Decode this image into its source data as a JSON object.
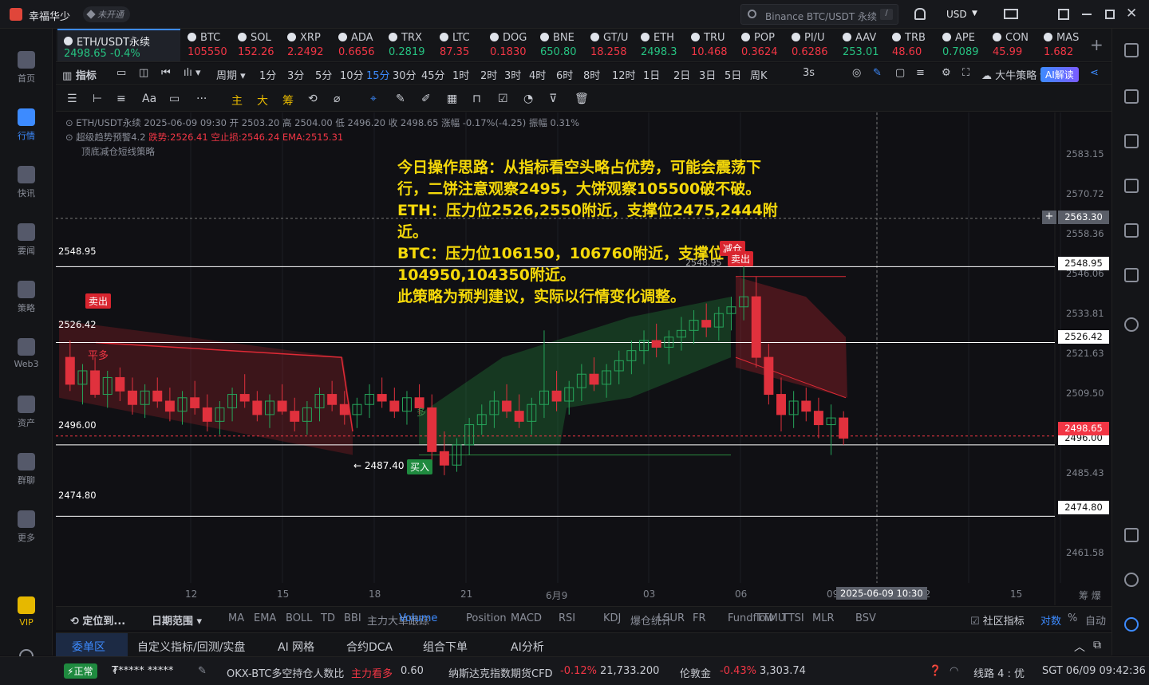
{
  "app": {
    "name": "幸福华少",
    "status": "未开通",
    "search": "Binance BTC/USDT 永续",
    "currency": "USD"
  },
  "nav": [
    "首页",
    "行情",
    "快讯",
    "要闻",
    "策略",
    "Web3",
    "资产",
    "群聊",
    "更多",
    "VIP"
  ],
  "active_tab": {
    "symbol": "ETH/USDT永续",
    "price": "2498.65",
    "change": "-0.4%"
  },
  "tickers": [
    {
      "name": "BTC",
      "price": "105550",
      "color": "red"
    },
    {
      "name": "SOL",
      "price": "152.26",
      "color": "red"
    },
    {
      "name": "XRP",
      "price": "2.2492",
      "color": "red"
    },
    {
      "name": "ADA",
      "price": "0.6656",
      "color": "red"
    },
    {
      "name": "TRX",
      "price": "0.2819",
      "color": "green"
    },
    {
      "name": "LTC",
      "price": "87.35",
      "color": "red"
    },
    {
      "name": "DOG",
      "price": "0.1830",
      "color": "red"
    },
    {
      "name": "BNE",
      "price": "650.80",
      "color": "green"
    },
    {
      "name": "GT/U",
      "price": "18.258",
      "color": "red"
    },
    {
      "name": "ETH",
      "price": "2498.3",
      "color": "green"
    },
    {
      "name": "TRU",
      "price": "10.468",
      "color": "red"
    },
    {
      "name": "POP",
      "price": "0.3624",
      "color": "red"
    },
    {
      "name": "PI/U",
      "price": "0.6286",
      "color": "red"
    },
    {
      "name": "AAV",
      "price": "253.01",
      "color": "green"
    },
    {
      "name": "TRB",
      "price": "48.60",
      "color": "red"
    },
    {
      "name": "APE",
      "price": "0.7089",
      "color": "green"
    },
    {
      "name": "CON",
      "price": "45.99",
      "color": "red"
    },
    {
      "name": "MAS",
      "price": "1.682",
      "color": "red"
    }
  ],
  "periods": [
    "指标",
    "周期",
    "1分",
    "3分",
    "5分",
    "10分",
    "15分",
    "30分",
    "45分",
    "1时",
    "2时",
    "3时",
    "4时",
    "6时",
    "8时",
    "12时",
    "1日",
    "2日",
    "3日",
    "5日",
    "周K",
    "3s",
    "大牛策略",
    "AI解读"
  ],
  "selected_period": "15分",
  "toolbar": [
    "主",
    "大",
    "筹"
  ],
  "legend": {
    "line1": "ETH/USDT永续 2025-06-09 09:30 开 2503.20 高 2504.00 低 2496.20 收 2498.65 涨幅 -0.17%(-4.25) 振幅 0.31%",
    "line2a": "超级趋势预警4.2",
    "line2b": "跌势:2526.41 空止损:2546.24 EMA:2515.31",
    "line3": "顶底减仓短线策略"
  },
  "annotation": "今日操作思路：从指标看空头略占优势，可能会震荡下行，二饼注意观察2495，大饼观察105500破不破。\nETH：压力位2526,2550附近，支撑位2475,2444附近。\nBTC：压力位106150，106760附近，支撑位104950,104350附近。\n此策略为预判建议，实际以行情变化调整。",
  "y_ticks": [
    "2583.15",
    "2570.72",
    "2558.36",
    "2546.06",
    "2533.81",
    "2521.63",
    "2509.50",
    "2485.43",
    "2461.58"
  ],
  "price_tags": {
    "crosshair": "2563.30",
    "l1": "2548.95",
    "l2": "2526.42",
    "l3": "2496.00",
    "last": "2498.65",
    "l4": "2474.80"
  },
  "line_labels": [
    "2548.95",
    "2526.42",
    "2496.00",
    "2474.80"
  ],
  "markers": {
    "sell": "卖出",
    "flat": "平多",
    "buy": "买入",
    "reduce": "减仓",
    "low": "← 2487.40",
    "high": "2548.95",
    "long": "多"
  },
  "x_ticks": [
    "12",
    "15",
    "18",
    "21",
    "6月9",
    "03",
    "06",
    "09",
    "12",
    "15"
  ],
  "crosshair_time": "2025-06-09 10:30",
  "bottom_tabs": [
    "定位到...",
    "日期范围",
    "MA",
    "EMA",
    "BOLL",
    "TD",
    "BBI",
    "主力大单跟踪",
    "Volume",
    "Position",
    "MACD",
    "RSI",
    "KDJ",
    "爆仓统计",
    "LSUR",
    "FR",
    "Fundflow",
    "TTMU",
    "TTSI",
    "MLR",
    "BSV",
    "社区指标",
    "对数",
    "%",
    "自动"
  ],
  "panel_tabs": [
    "委单区",
    "自定义指标/回测/实盘",
    "AI 网格",
    "合约DCA",
    "组合下单",
    "AI分析"
  ],
  "status": {
    "mode": "正常",
    "acct": "₮***** *****",
    "item1": "OKX-BTC多空持仓人数比",
    "item1b": "主力看多",
    "item1v": "0.60",
    "item2": "纳斯达克指数期货CFD",
    "item2c": "-0.12%",
    "item2v": "21,733.200",
    "item3": "伦敦金",
    "item3c": "-0.43%",
    "item3v": "3,303.74",
    "line": "线路 4 : 优",
    "time": "SGT 06/09 09:42:36"
  },
  "chart_data": {
    "type": "candlestick",
    "symbol": "ETH/USDT永续",
    "ylim": [
      2455,
      2590
    ],
    "horizontal_lines": [
      2548.95,
      2526.42,
      2496.0,
      2474.8
    ],
    "last_price": 2498.65,
    "candles": [
      [
        2522,
        2527,
        2512,
        2514
      ],
      [
        2514,
        2520,
        2508,
        2518
      ],
      [
        2518,
        2522,
        2510,
        2511
      ],
      [
        2511,
        2518,
        2507,
        2516
      ],
      [
        2516,
        2519,
        2509,
        2512
      ],
      [
        2512,
        2516,
        2505,
        2508
      ],
      [
        2508,
        2514,
        2504,
        2512
      ],
      [
        2512,
        2516,
        2507,
        2509
      ],
      [
        2509,
        2513,
        2503,
        2506
      ],
      [
        2506,
        2512,
        2502,
        2510
      ],
      [
        2510,
        2515,
        2505,
        2507
      ],
      [
        2507,
        2511,
        2500,
        2503
      ],
      [
        2503,
        2509,
        2499,
        2507
      ],
      [
        2507,
        2513,
        2503,
        2511
      ],
      [
        2511,
        2517,
        2507,
        2509
      ],
      [
        2509,
        2512,
        2503,
        2505
      ],
      [
        2505,
        2511,
        2501,
        2509
      ],
      [
        2509,
        2514,
        2505,
        2506
      ],
      [
        2506,
        2510,
        2500,
        2503
      ],
      [
        2503,
        2509,
        2499,
        2507
      ],
      [
        2507,
        2513,
        2503,
        2511
      ],
      [
        2511,
        2515,
        2506,
        2508
      ],
      [
        2508,
        2512,
        2502,
        2505
      ],
      [
        2505,
        2510,
        2501,
        2508
      ],
      [
        2508,
        2514,
        2504,
        2511
      ],
      [
        2511,
        2516,
        2507,
        2509
      ],
      [
        2509,
        2513,
        2504,
        2506
      ],
      [
        2506,
        2512,
        2502,
        2510
      ],
      [
        2510,
        2514,
        2505,
        2507
      ],
      [
        2507,
        2511,
        2489,
        2494
      ],
      [
        2494,
        2500,
        2487,
        2490
      ],
      [
        2490,
        2498,
        2488,
        2496
      ],
      [
        2496,
        2504,
        2493,
        2502
      ],
      [
        2502,
        2508,
        2499,
        2505
      ],
      [
        2505,
        2512,
        2501,
        2509
      ],
      [
        2509,
        2514,
        2504,
        2506
      ],
      [
        2506,
        2511,
        2501,
        2503
      ],
      [
        2503,
        2510,
        2499,
        2508
      ],
      [
        2508,
        2530,
        2504,
        2512
      ],
      [
        2512,
        2518,
        2506,
        2509
      ],
      [
        2509,
        2515,
        2505,
        2513
      ],
      [
        2513,
        2520,
        2509,
        2517
      ],
      [
        2517,
        2522,
        2512,
        2514
      ],
      [
        2514,
        2520,
        2510,
        2518
      ],
      [
        2518,
        2524,
        2514,
        2521
      ],
      [
        2521,
        2527,
        2517,
        2524
      ],
      [
        2524,
        2530,
        2520,
        2527
      ],
      [
        2527,
        2532,
        2522,
        2525
      ],
      [
        2525,
        2530,
        2520,
        2528
      ],
      [
        2528,
        2534,
        2524,
        2530
      ],
      [
        2530,
        2536,
        2526,
        2533
      ],
      [
        2533,
        2538,
        2528,
        2531
      ],
      [
        2531,
        2537,
        2527,
        2535
      ],
      [
        2535,
        2540,
        2530,
        2537
      ],
      [
        2537,
        2550,
        2533,
        2540
      ],
      [
        2540,
        2546,
        2519,
        2522
      ],
      [
        2522,
        2526,
        2508,
        2511
      ],
      [
        2511,
        2516,
        2500,
        2505
      ],
      [
        2505,
        2512,
        2501,
        2509
      ],
      [
        2509,
        2513,
        2503,
        2506
      ],
      [
        2506,
        2510,
        2498,
        2502
      ],
      [
        2502,
        2508,
        2493,
        2504
      ],
      [
        2504,
        2506,
        2496,
        2498
      ]
    ]
  }
}
